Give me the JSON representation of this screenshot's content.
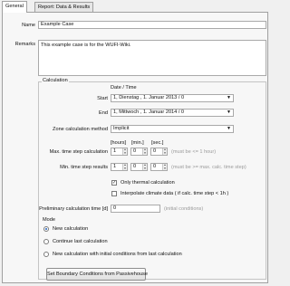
{
  "tabs": [
    {
      "label": "General",
      "active": true
    },
    {
      "label": "Report: Data & Results",
      "active": false
    }
  ],
  "general": {
    "name_label": "Name",
    "name_value": "Example Case",
    "remarks_label": "Remarks",
    "remarks_value": "This example case is for the WUFI-Wiki."
  },
  "calculation": {
    "section_label": "Calculation",
    "date_time_header": "Date / Time",
    "start_label": "Start",
    "start_value": "1, Dienstag , 1. Januar 2013 / 0",
    "end_label": "End",
    "end_value": "1, Mittwoch , 1. Januar 2014 / 0",
    "zone_method_label": "Zone calculation method",
    "zone_method_value": "Implicit",
    "hours_header": "[hours]",
    "min_header": "[min.]",
    "sec_header": "[sec.]",
    "max_step_label": "Max. time step calculation",
    "max_step": {
      "hours": "1",
      "min": "0",
      "sec": "0",
      "hint": "(must be <= 1 hour)"
    },
    "min_step_label": "Min. time step results",
    "min_step": {
      "hours": "1",
      "min": "0",
      "sec": "0",
      "hint": "(must be >= max. calc. time step)"
    },
    "only_thermal_label": "Only thermal calculation",
    "only_thermal_checked": true,
    "interpolate_label": "Interpolate climate data ( if calc. time step < 1h )",
    "interpolate_checked": false,
    "prelim_label": "Preliminary calculation time  [d]",
    "prelim_value": "0",
    "prelim_hint": "(initial conditions)"
  },
  "mode": {
    "section_label": "Mode",
    "options": [
      {
        "label": "New calculation",
        "selected": true
      },
      {
        "label": "Continue last calculation",
        "selected": false
      },
      {
        "label": "New calculation with initial conditions from last calculation",
        "selected": false
      }
    ]
  },
  "passivehouse_button": "Set Boundary Conditions from Passivehouse",
  "colors": {
    "radio_accent": "#1f5fbf"
  }
}
